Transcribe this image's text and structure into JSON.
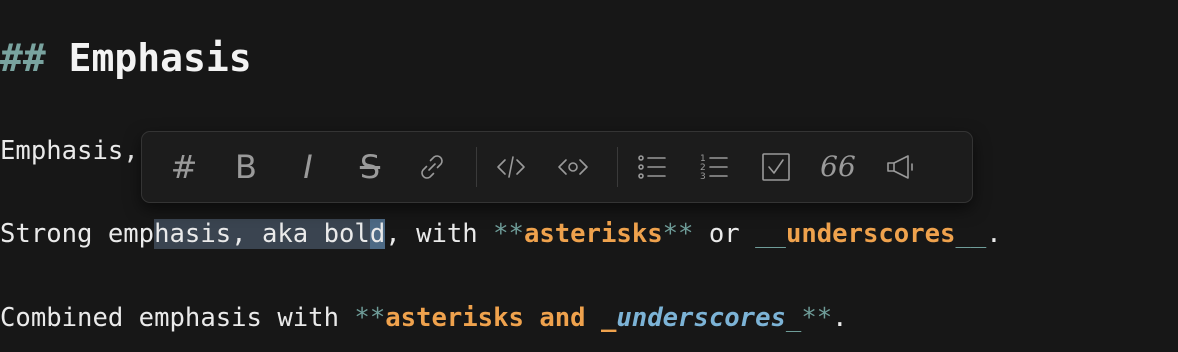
{
  "heading": {
    "marker": "##",
    "title": "Emphasis"
  },
  "line1": {
    "text": "Emphasis,"
  },
  "line2": {
    "a": "Strong emp",
    "sel": "hasis, aka bol",
    "cur": "d",
    "b": ", with ",
    "m1": "**",
    "w1": "asterisks",
    "m2": "**",
    "c": " or ",
    "u1": "__",
    "w2": "underscores",
    "u2": "__",
    "end": "."
  },
  "line3": {
    "a": "Combined emphasis with ",
    "m1": "**",
    "w1": "asterisks and ",
    "u1": "_",
    "w2": "underscores",
    "u2": "_",
    "m2": "**",
    "end": "."
  },
  "toolbar": {
    "items": [
      "heading-icon",
      "bold-icon",
      "italic-icon",
      "strikethrough-icon",
      "link-icon",
      "code-icon",
      "preview-icon",
      "bullet-list-icon",
      "numbered-list-icon",
      "checkbox-icon",
      "quote-icon",
      "callout-icon"
    ],
    "heading_glyph": "#",
    "bold_glyph": "B",
    "italic_glyph": "I",
    "strike_glyph": "S",
    "quote_glyph": "66"
  },
  "colors": {
    "background": "#171717",
    "markdown_syntax": "#6f9d99",
    "bold_text": "#efa24d",
    "italic_text": "#7cb3d6",
    "selection": "#3a4450"
  }
}
